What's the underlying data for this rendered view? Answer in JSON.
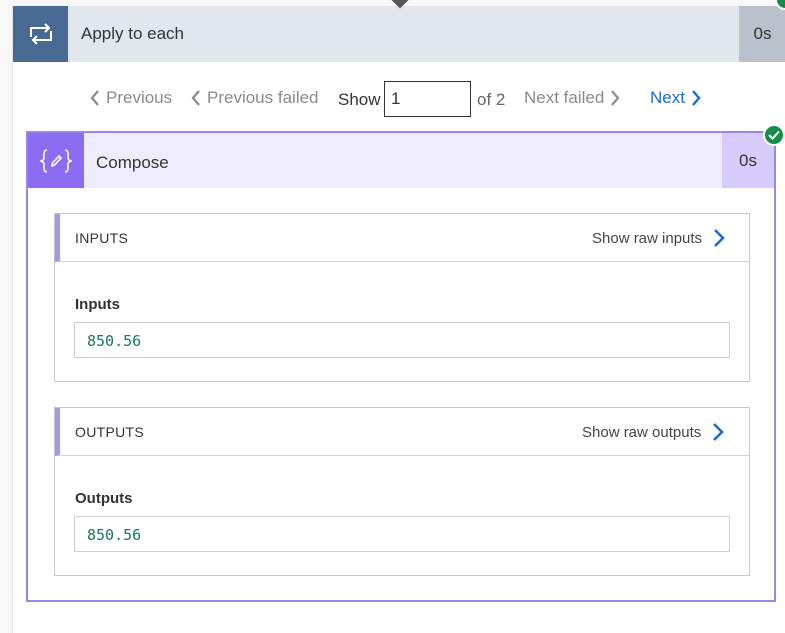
{
  "loop": {
    "title": "Apply to each",
    "duration": "0s",
    "icon": "loop-icon",
    "status": "succeeded"
  },
  "pager": {
    "previous": "Previous",
    "previous_failed": "Previous failed",
    "show_label": "Show",
    "current_value": "1",
    "of_label": "of 2",
    "next_failed": "Next failed",
    "next": "Next"
  },
  "compose": {
    "title": "Compose",
    "duration": "0s",
    "icon": "compose-icon",
    "status": "succeeded",
    "inputs": {
      "header": "INPUTS",
      "raw_link": "Show raw inputs",
      "field_label": "Inputs",
      "value": "850.56"
    },
    "outputs": {
      "header": "OUTPUTS",
      "raw_link": "Show raw outputs",
      "field_label": "Outputs",
      "value": "850.56"
    }
  },
  "colors": {
    "loop_accent": "#486991",
    "compose_accent": "#8c6cf2",
    "link_blue": "#1d6bd6",
    "success_green": "#168c4b",
    "value_green": "#1b7560"
  }
}
